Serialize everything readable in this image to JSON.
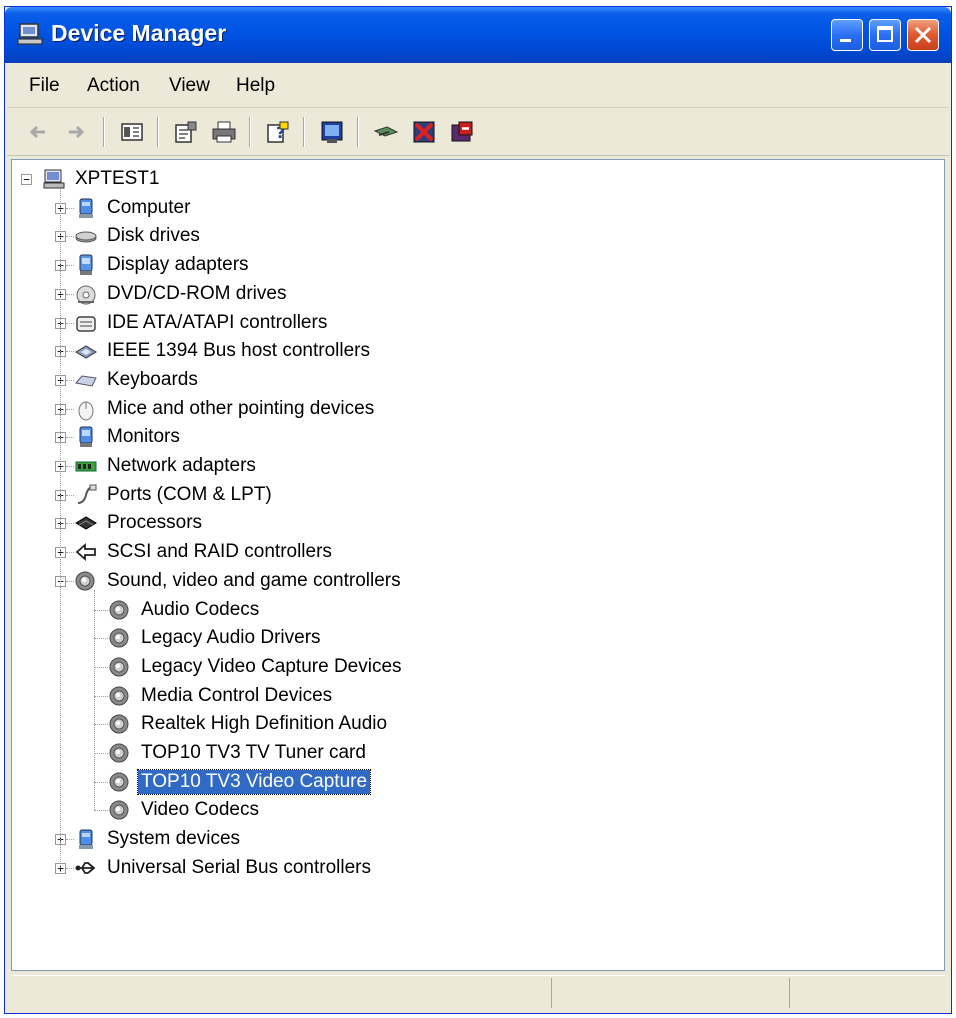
{
  "window": {
    "title": "Device Manager"
  },
  "menu": [
    "File",
    "Action",
    "View",
    "Help"
  ],
  "toolbar_icons": [
    "back-arrow-icon",
    "forward-arrow-icon",
    "show-hide-console-tree-icon",
    "properties-icon",
    "print-icon",
    "help-icon",
    "scan-hardware-icon",
    "update-driver-icon",
    "uninstall-icon",
    "disable-icon"
  ],
  "tree": {
    "root": "XPTEST1",
    "categories": [
      {
        "label": "Computer",
        "icon": "computer-icon",
        "expanded": false
      },
      {
        "label": "Disk drives",
        "icon": "disk-drive-icon",
        "expanded": false
      },
      {
        "label": "Display adapters",
        "icon": "display-adapter-icon",
        "expanded": false
      },
      {
        "label": "DVD/CD-ROM drives",
        "icon": "dvd-drive-icon",
        "expanded": false
      },
      {
        "label": "IDE ATA/ATAPI controllers",
        "icon": "ide-controller-icon",
        "expanded": false
      },
      {
        "label": "IEEE 1394 Bus host controllers",
        "icon": "firewire-icon",
        "expanded": false
      },
      {
        "label": "Keyboards",
        "icon": "keyboard-icon",
        "expanded": false
      },
      {
        "label": "Mice and other pointing devices",
        "icon": "mouse-icon",
        "expanded": false
      },
      {
        "label": "Monitors",
        "icon": "monitor-icon",
        "expanded": false
      },
      {
        "label": "Network adapters",
        "icon": "network-adapter-icon",
        "expanded": false
      },
      {
        "label": "Ports (COM & LPT)",
        "icon": "port-icon",
        "expanded": false
      },
      {
        "label": "Processors",
        "icon": "processor-icon",
        "expanded": false
      },
      {
        "label": "SCSI and RAID controllers",
        "icon": "scsi-icon",
        "expanded": false
      },
      {
        "label": "Sound, video and game controllers",
        "icon": "speaker-icon",
        "expanded": true,
        "children": [
          {
            "label": "Audio Codecs",
            "icon": "speaker-icon",
            "selected": false
          },
          {
            "label": "Legacy Audio Drivers",
            "icon": "speaker-icon",
            "selected": false
          },
          {
            "label": "Legacy Video Capture Devices",
            "icon": "speaker-icon",
            "selected": false
          },
          {
            "label": "Media Control Devices",
            "icon": "speaker-icon",
            "selected": false
          },
          {
            "label": "Realtek High Definition Audio",
            "icon": "speaker-icon",
            "selected": false
          },
          {
            "label": "TOP10 TV3 TV Tuner card",
            "icon": "speaker-icon",
            "selected": false
          },
          {
            "label": "TOP10 TV3 Video Capture",
            "icon": "speaker-icon",
            "selected": true
          },
          {
            "label": "Video Codecs",
            "icon": "speaker-icon",
            "selected": false
          }
        ]
      },
      {
        "label": "System devices",
        "icon": "computer-icon",
        "expanded": false
      },
      {
        "label": "Universal Serial Bus controllers",
        "icon": "usb-icon",
        "expanded": false
      }
    ]
  },
  "colors": {
    "selection": "#316ac5",
    "titlebar": "#0054e3",
    "chrome": "#ece9d8"
  }
}
